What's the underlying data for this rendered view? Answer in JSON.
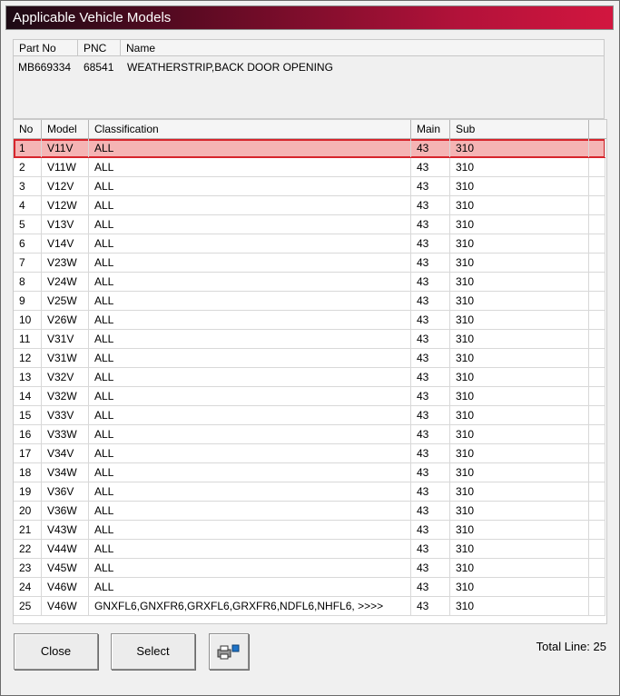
{
  "window": {
    "title": "Applicable Vehicle Models"
  },
  "parts": {
    "headers": [
      "Part No",
      "PNC",
      "Name"
    ],
    "row": {
      "part_no": "MB669334",
      "pnc": "68541",
      "name": "WEATHERSTRIP,BACK DOOR OPENING"
    }
  },
  "grid": {
    "headers": [
      "No",
      "Model",
      "Classification",
      "Main",
      "Sub"
    ],
    "selected_index": 0,
    "rows": [
      {
        "no": "1",
        "model": "V11V",
        "classification": "ALL",
        "main": "43",
        "sub": "310"
      },
      {
        "no": "2",
        "model": "V11W",
        "classification": "ALL",
        "main": "43",
        "sub": "310"
      },
      {
        "no": "3",
        "model": "V12V",
        "classification": "ALL",
        "main": "43",
        "sub": "310"
      },
      {
        "no": "4",
        "model": "V12W",
        "classification": "ALL",
        "main": "43",
        "sub": "310"
      },
      {
        "no": "5",
        "model": "V13V",
        "classification": "ALL",
        "main": "43",
        "sub": "310"
      },
      {
        "no": "6",
        "model": "V14V",
        "classification": "ALL",
        "main": "43",
        "sub": "310"
      },
      {
        "no": "7",
        "model": "V23W",
        "classification": "ALL",
        "main": "43",
        "sub": "310"
      },
      {
        "no": "8",
        "model": "V24W",
        "classification": "ALL",
        "main": "43",
        "sub": "310"
      },
      {
        "no": "9",
        "model": "V25W",
        "classification": "ALL",
        "main": "43",
        "sub": "310"
      },
      {
        "no": "10",
        "model": "V26W",
        "classification": "ALL",
        "main": "43",
        "sub": "310"
      },
      {
        "no": "11",
        "model": "V31V",
        "classification": "ALL",
        "main": "43",
        "sub": "310"
      },
      {
        "no": "12",
        "model": "V31W",
        "classification": "ALL",
        "main": "43",
        "sub": "310"
      },
      {
        "no": "13",
        "model": "V32V",
        "classification": "ALL",
        "main": "43",
        "sub": "310"
      },
      {
        "no": "14",
        "model": "V32W",
        "classification": "ALL",
        "main": "43",
        "sub": "310"
      },
      {
        "no": "15",
        "model": "V33V",
        "classification": "ALL",
        "main": "43",
        "sub": "310"
      },
      {
        "no": "16",
        "model": "V33W",
        "classification": "ALL",
        "main": "43",
        "sub": "310"
      },
      {
        "no": "17",
        "model": "V34V",
        "classification": "ALL",
        "main": "43",
        "sub": "310"
      },
      {
        "no": "18",
        "model": "V34W",
        "classification": "ALL",
        "main": "43",
        "sub": "310"
      },
      {
        "no": "19",
        "model": "V36V",
        "classification": "ALL",
        "main": "43",
        "sub": "310"
      },
      {
        "no": "20",
        "model": "V36W",
        "classification": "ALL",
        "main": "43",
        "sub": "310"
      },
      {
        "no": "21",
        "model": "V43W",
        "classification": "ALL",
        "main": "43",
        "sub": "310"
      },
      {
        "no": "22",
        "model": "V44W",
        "classification": "ALL",
        "main": "43",
        "sub": "310"
      },
      {
        "no": "23",
        "model": "V45W",
        "classification": "ALL",
        "main": "43",
        "sub": "310"
      },
      {
        "no": "24",
        "model": "V46W",
        "classification": "ALL",
        "main": "43",
        "sub": "310"
      },
      {
        "no": "25",
        "model": "V46W",
        "classification": "GNXFL6,GNXFR6,GRXFL6,GRXFR6,NDFL6,NHFL6,  >>>>",
        "main": "43",
        "sub": "310"
      }
    ]
  },
  "footer": {
    "close_label": "Close",
    "select_label": "Select",
    "print_icon": "printer-icon",
    "total_label": "Total Line: 25"
  },
  "colors": {
    "title_start": "#1c0a14",
    "title_end": "#d2163f",
    "selected_row": "#f5b4b4",
    "selected_border": "#d7252c"
  }
}
